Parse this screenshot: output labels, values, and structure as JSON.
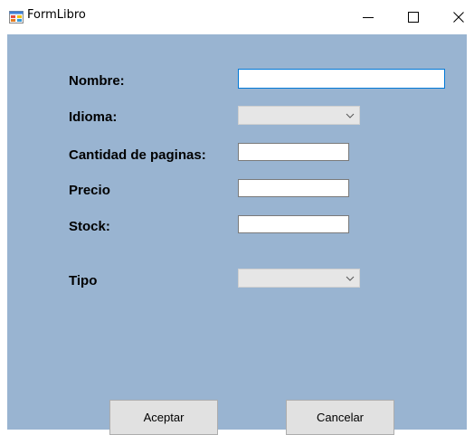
{
  "window": {
    "title": "FormLibro"
  },
  "form": {
    "nombre_label": "Nombre:",
    "nombre_value": "",
    "idioma_label": "Idioma:",
    "idioma_value": "",
    "paginas_label": "Cantidad de paginas:",
    "paginas_value": "",
    "precio_label": "Precio",
    "precio_value": "",
    "stock_label": "Stock:",
    "stock_value": "",
    "tipo_label": "Tipo",
    "tipo_value": ""
  },
  "buttons": {
    "aceptar": "Aceptar",
    "cancelar": "Cancelar"
  },
  "colors": {
    "client_background": "#99b4d1",
    "focus_border": "#0078d7"
  }
}
